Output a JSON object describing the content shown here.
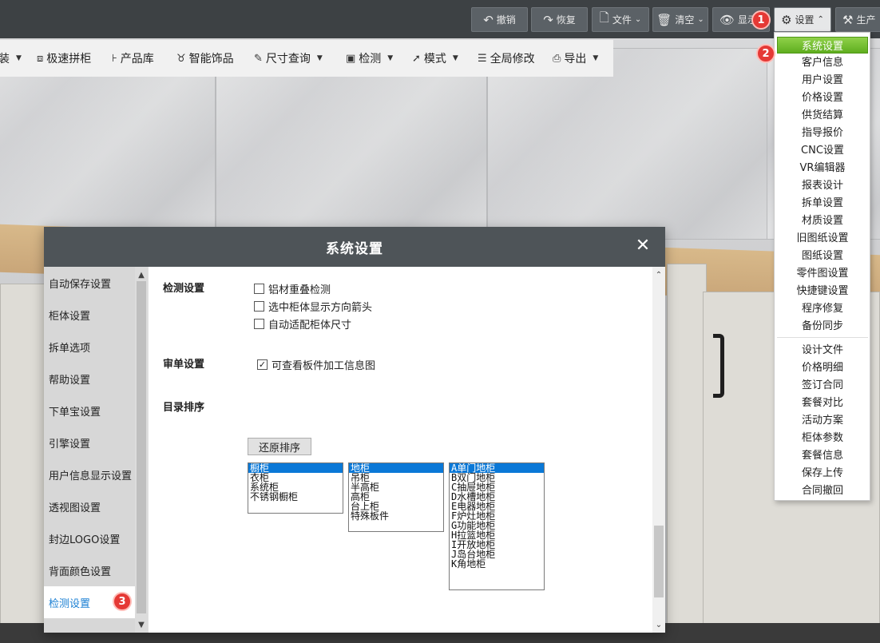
{
  "topbar": {
    "undo": "撤销",
    "redo": "恢复",
    "file": "文件",
    "clear": "清空",
    "display": "显示",
    "settings": "设置",
    "production": "生产"
  },
  "toolbar2": {
    "item0": "装",
    "item1": "极速拼柜",
    "item2": "产品库",
    "item3": "智能饰品",
    "item4": "尺寸查询",
    "item5": "检测",
    "item6": "模式",
    "item7": "全局修改",
    "item8": "导出"
  },
  "badges": [
    "1",
    "2",
    "3"
  ],
  "dropdown": {
    "items": [
      "系统设置",
      "客户信息",
      "用户设置",
      "价格设置",
      "供货结算",
      "指导报价",
      "CNC设置",
      "VR编辑器",
      "报表设计",
      "拆单设置",
      "材质设置",
      "旧图纸设置",
      "图纸设置",
      "零件图设置",
      "快捷键设置",
      "程序修复",
      "备份同步"
    ],
    "items2": [
      "设计文件",
      "价格明细",
      "签订合同",
      "套餐对比",
      "活动方案",
      "柜体参数",
      "套餐信息",
      "保存上传",
      "合同撤回"
    ]
  },
  "dialog": {
    "title": "系统设置",
    "left_items": [
      "自动保存设置",
      "柜体设置",
      "拆单选项",
      "帮助设置",
      "下单宝设置",
      "引擎设置",
      "用户信息显示设置",
      "透视图设置",
      "封边LOGO设置",
      "背面颜色设置",
      "检测设置"
    ],
    "detect_label": "检测设置",
    "detect_opts": [
      "铝材重叠检测",
      "选中柜体显示方向箭头",
      "自动适配柜体尺寸"
    ],
    "review_label": "审单设置",
    "review_opt": "可查看板件加工信息图",
    "sort_label": "目录排序",
    "reset_btn": "还原排序",
    "list1": [
      "橱柜",
      "衣柜",
      "系统柜",
      "不锈钢橱柜"
    ],
    "list2": [
      "地柜",
      "吊柜",
      "半高柜",
      "高柜",
      "台上柜",
      "特殊板件"
    ],
    "list3": [
      "A单门地柜",
      "B双门地柜",
      "C抽屉地柜",
      "D水槽地柜",
      "E电器地柜",
      "F炉灶地柜",
      "G功能地柜",
      "H拉篮地柜",
      "I开放地柜",
      "J岛台地柜",
      "K角地柜"
    ]
  }
}
